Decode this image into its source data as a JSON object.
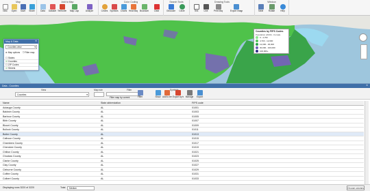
{
  "ribbon": {
    "groups": [
      "Map",
      "Add to Map",
      "Color Coding",
      "Search Tools",
      "Drawing Tools",
      "Window"
    ],
    "buttons": [
      "New",
      "Open",
      "Save",
      "Share",
      "Data",
      "Dataset",
      "Territories",
      "Map Layers",
      "Analyze",
      "Circles",
      "Symbols",
      "Charts",
      "Heat Map",
      "Boundaries",
      "Clear",
      "Geocode",
      "Circle",
      "Text",
      "Line",
      "Print Map",
      "Export Image",
      "Table",
      "Rotate",
      "Help"
    ]
  },
  "layers_panel": {
    "title": "Map & Data",
    "view_value": "Counties view",
    "map_options": "Map options",
    "filter_map": "Filter map",
    "items": [
      "States",
      "Counties",
      "ZIP Codes",
      "Streets"
    ]
  },
  "legend": {
    "title": "Counties by FIPS Codes",
    "subtitle": "Population (2020) - Female",
    "entries": [
      "0 - 4,702",
      "4,703 - 12,000",
      "12,000 - 30,000",
      "30,000 - 100,000",
      "100,000+"
    ],
    "colors": [
      "#8de58f",
      "#53c85b",
      "#2aa44a",
      "#6b5db8",
      "#2f2a88"
    ]
  },
  "data_panel": {
    "title": "Data - Counties",
    "view_label": "View",
    "view_value": "Counties",
    "map_rule_label": "Map rule",
    "filter_label": "Filter",
    "filter_text": "Filter map by current",
    "symbols_label": "Symbols",
    "tool_buttons": [
      "Filter",
      "Show",
      "Add to territory",
      "Export by territory",
      "Manage",
      "Export"
    ]
  },
  "table": {
    "columns": [
      "Name",
      "State abbreviation",
      "FIPS code"
    ],
    "rows": [
      [
        "Autauga County",
        "AL",
        "01001"
      ],
      [
        "Baldwin County",
        "AL",
        "01003"
      ],
      [
        "Barbour County",
        "AL",
        "01005"
      ],
      [
        "Bibb County",
        "AL",
        "01007"
      ],
      [
        "Blount County",
        "AL",
        "01009"
      ],
      [
        "Bullock County",
        "AL",
        "01011"
      ],
      [
        "Butler County",
        "AL",
        "01013"
      ],
      [
        "Calhoun County",
        "AL",
        "01015"
      ],
      [
        "Chambers County",
        "AL",
        "01017"
      ],
      [
        "Cherokee County",
        "AL",
        "01019"
      ],
      [
        "Chilton County",
        "AL",
        "01021"
      ],
      [
        "Choctaw County",
        "AL",
        "01023"
      ],
      [
        "Clarke County",
        "AL",
        "01025"
      ],
      [
        "Clay County",
        "AL",
        "01027"
      ],
      [
        "Cleburne County",
        "AL",
        "01029"
      ],
      [
        "Coffee County",
        "AL",
        "01031"
      ],
      [
        "Colbert County",
        "AL",
        "01033"
      ]
    ]
  },
  "status": {
    "count_text": "Displaying rows 3220 of 3220",
    "total_label": "Total",
    "total_value": "Median",
    "right_button": "Choose columns"
  }
}
